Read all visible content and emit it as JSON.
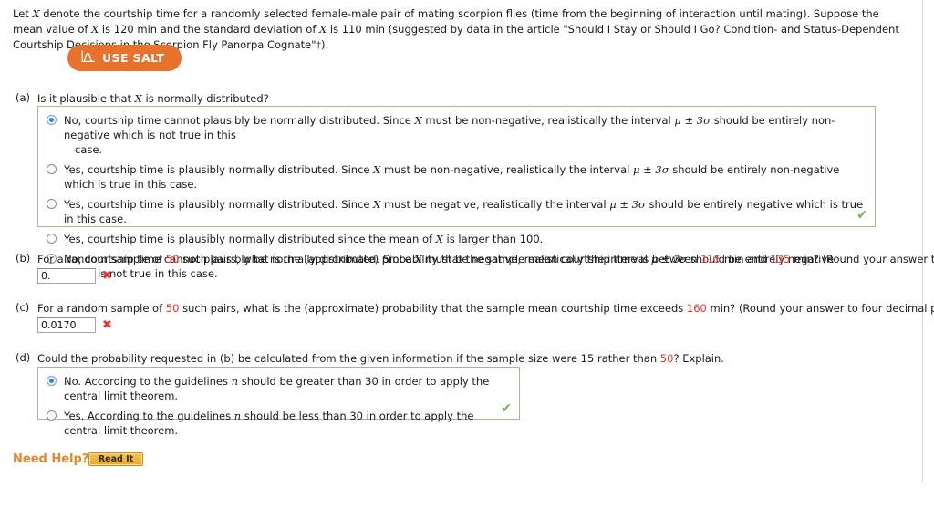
{
  "problem": {
    "line1_a": "Let ",
    "line1_var": "X",
    "line1_b": " denote the courtship time for a randomly selected female-male pair of mating scorpion flies (time from the beginning of interaction until mating). Suppose the mean value of ",
    "line1_c": " is 120 min and the",
    "line2_a": "standard deviation of ",
    "line2_b": " is 110 min (suggested by data in the article \"Should I Stay or Should I Go? Condition- and Status-Dependent Courtship Decisions in the Scorpion Fly Panorpa Cognate\"",
    "footnote": "†",
    "line2_c": ")."
  },
  "salt_button": {
    "label": "USE SALT",
    "icon": "distribution-curve-icon",
    "color": "#e8712c"
  },
  "parts": {
    "a": {
      "label": "(a)",
      "question_pre": "Is it plausible that ",
      "question_var": "X",
      "question_post": " is normally distributed?",
      "options": [
        {
          "selected": true,
          "text_1": "No, courtship time cannot plausibly be normally distributed. Since ",
          "var": "X",
          "text_2": " must be non-negative, realistically the interval ",
          "interval": "μ ± 3σ",
          "text_3": " should be entirely non-negative which is not true in this",
          "text_wrap": "case."
        },
        {
          "selected": false,
          "text_1": "Yes, courtship time is plausibly normally distributed. Since ",
          "var": "X",
          "text_2": " must be non-negative, realistically the interval ",
          "interval": "μ ± 3σ",
          "text_3": " should be entirely non-negative which is true in this case.",
          "text_wrap": ""
        },
        {
          "selected": false,
          "text_1": "Yes, courtship time is plausibly normally distributed. Since ",
          "var": "X",
          "text_2": " must be negative, realistically the interval ",
          "interval": "μ ± 3σ",
          "text_3": " should be entirely negative which is true in this case.",
          "text_wrap": ""
        },
        {
          "selected": false,
          "text_1": "Yes, courtship time is plausibly normally distributed since the mean of ",
          "var": "X",
          "text_2": " is larger than 100.",
          "interval": "",
          "text_3": "",
          "text_wrap": ""
        },
        {
          "selected": false,
          "text_1": "No, courtship time cannot plausibly be normally distributed. Since ",
          "var": "X",
          "text_2": " must be negative, realistically the interval ",
          "interval": "μ ± 3σ",
          "text_3": " should be entirely negative which is not true in this case.",
          "text_wrap": ""
        }
      ],
      "status_icon": "green-check-icon"
    },
    "b": {
      "label": "(b)",
      "q_1": "For a random sample of ",
      "n": "50",
      "q_2": " such pairs, what is the (approximate) probability that the sample mean courtship time is between ",
      "lower": "115",
      "q_3": " min and ",
      "upper": "135",
      "q_4": " min? (Round your answer to four decimal places.)",
      "answer_value": "0.",
      "status_icon": "red-x-icon"
    },
    "c": {
      "label": "(c)",
      "q_1": "For a random sample of ",
      "n": "50",
      "q_2": " such pairs, what is the (approximate) probability that the sample mean courtship time exceeds ",
      "threshold": "160",
      "q_3": " min? (Round your answer to four decimal places.)",
      "answer_value": "0.0170",
      "status_icon": "red-x-icon"
    },
    "d": {
      "label": "(d)",
      "q_1": "Could the probability requested in (b) be calculated from the given information if the sample size were 15 rather than ",
      "n": "50",
      "q_2": "? Explain.",
      "options": [
        {
          "selected": true,
          "text_1": "No. According to the guidelines ",
          "var": "n",
          "text_2": " should be greater than 30 in order to apply the central limit theorem."
        },
        {
          "selected": false,
          "text_1": "Yes. According to the guidelines ",
          "var": "n",
          "text_2": " should be less than 30 in order to apply the central limit theorem."
        }
      ],
      "status_icon": "green-check-icon"
    }
  },
  "help": {
    "label": "Need Help?",
    "button_label": "Read It"
  },
  "icons": {
    "check": "✔",
    "cross": "✖"
  }
}
